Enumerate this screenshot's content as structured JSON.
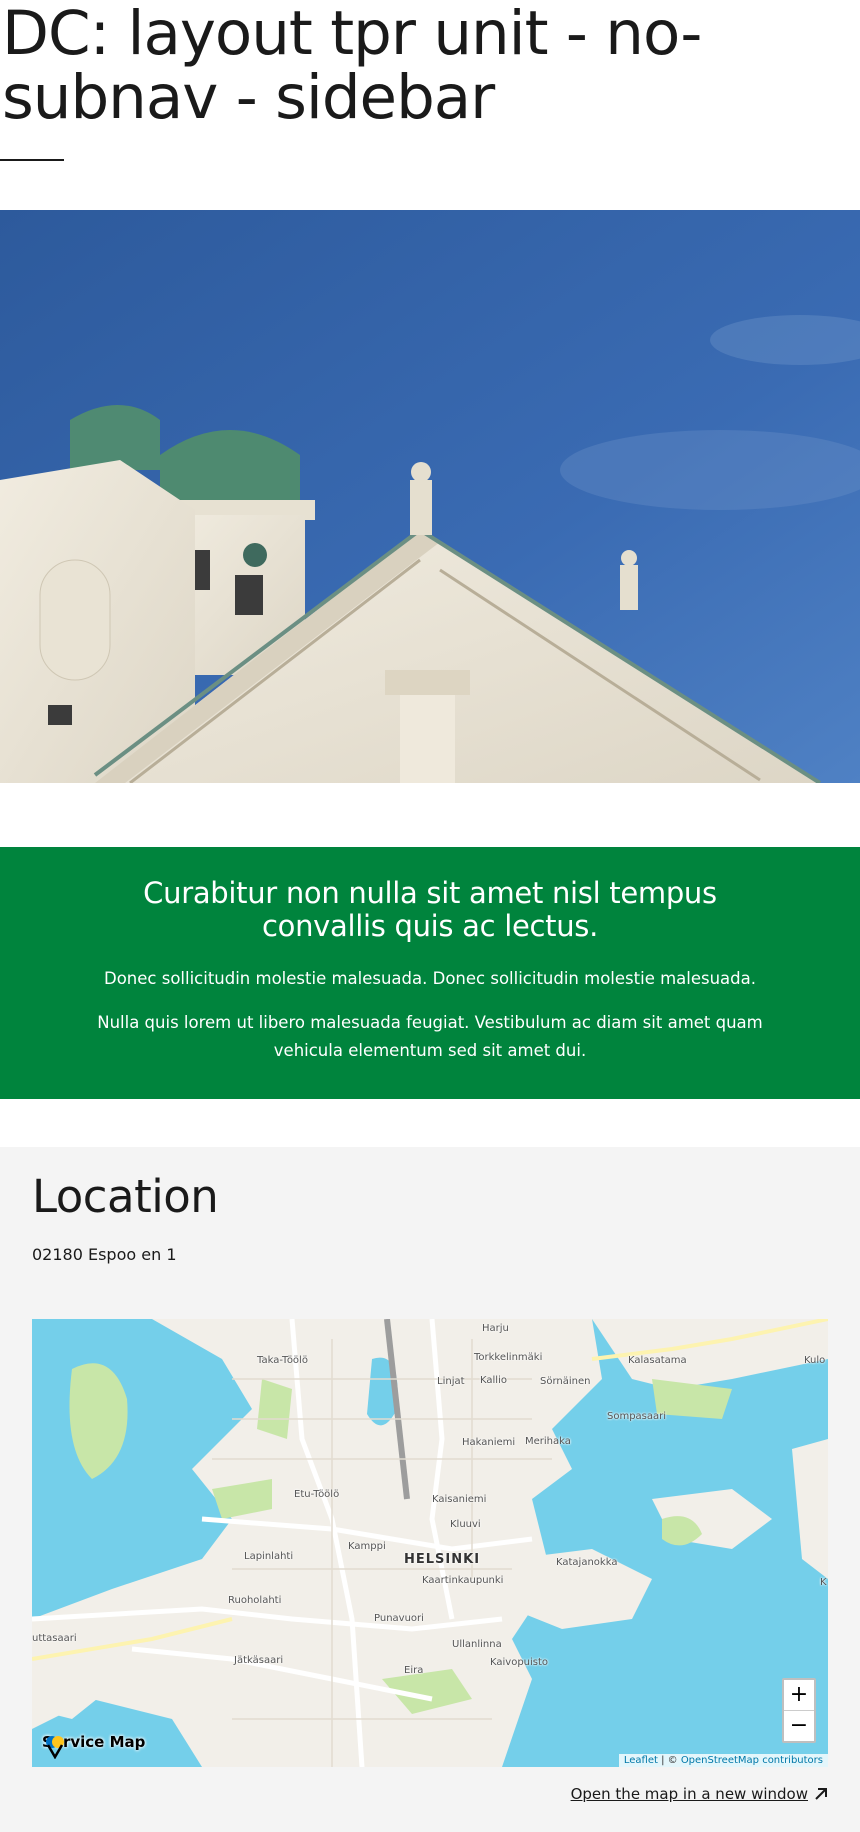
{
  "page": {
    "title": "DC: layout tpr unit - no-subnav - sidebar"
  },
  "hero": {
    "image": "cathedral-photo"
  },
  "banner": {
    "title": "Curabitur non nulla sit amet nisl tempus convallis quis ac lectus.",
    "paragraph_1": "Donec sollicitudin molestie malesuada. Donec sollicitudin molestie malesuada.",
    "paragraph_2": "Nulla quis lorem ut libero malesuada feugiat. Vestibulum ac diam sit amet quam vehicula elementum sed sit amet dui.",
    "background_color": "#00843d"
  },
  "location": {
    "heading": "Location",
    "address": "02180 Espoo en 1",
    "map": {
      "labels": {
        "harju": "Harju",
        "taka_toolo": "Taka-Töölö",
        "torkkelinmaki": "Torkkelinmäki",
        "kalasatama": "Kalasatama",
        "kulo": "Kulo",
        "linjat": "Linjat",
        "kallio": "Kallio",
        "sornainen": "Sörnäinen",
        "sompasaari": "Sompasaari",
        "hakaniemi": "Hakaniemi",
        "merihaka": "Merihaka",
        "etu_toolo": "Etu-Töölö",
        "kaisaniemi": "Kaisaniemi",
        "kluuvi": "Kluuvi",
        "kamppi": "Kamppi",
        "helsinki": "HELSINKI",
        "kaartinkaupunki": "Kaartinkaupunki",
        "katajanokka": "Katajanokka",
        "lapinlahti": "Lapinlahti",
        "ruoholahti": "Ruoholahti",
        "punavuori": "Punavuori",
        "jatkasaari": "Jätkäsaari",
        "ullanlinna": "Ullanlinna",
        "kaivopuisto": "Kaivopuisto",
        "eira": "Eira",
        "lauttasaari": "uttasaari",
        "k": "K"
      },
      "zoom_in": "+",
      "zoom_out": "−",
      "service_map": "Service Map",
      "attribution_leaflet": "Leaflet",
      "attribution_sep": " | © ",
      "attribution_osm": "OpenStreetMap contributors",
      "water_color": "#74cfea",
      "land_color": "#f2efe9",
      "park_color": "#c8e6a8"
    },
    "open_map_link": "Open the map in a new window"
  }
}
